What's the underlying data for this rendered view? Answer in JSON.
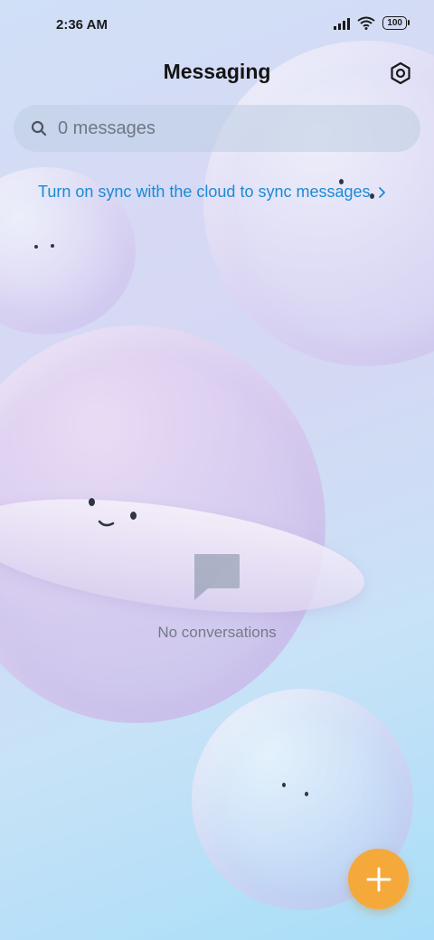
{
  "status_bar": {
    "time": "2:36 AM",
    "battery": "100"
  },
  "header": {
    "title": "Messaging",
    "settings_icon": "settings-hexagon-icon"
  },
  "search": {
    "placeholder": "0 messages",
    "icon": "search-icon"
  },
  "sync_banner": {
    "text": "Turn on sync with the cloud to sync messages",
    "color": "#1a8ad6"
  },
  "empty_state": {
    "icon": "message-bubble-icon",
    "text": "No conversations"
  },
  "fab": {
    "icon": "plus-icon",
    "color": "#f5a93a"
  }
}
